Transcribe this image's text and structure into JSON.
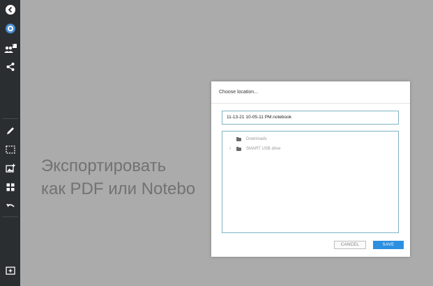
{
  "overlay": {
    "line1": "Экспортировать",
    "line2": "как PDF или Notebo"
  },
  "dialog": {
    "title": "Choose location...",
    "filename": "11-13-21 10-05-11 PM.notebook",
    "folders": [
      {
        "label": "Downloads",
        "expandable": false
      },
      {
        "label": "SMART USB drive",
        "expandable": true
      }
    ],
    "cancel_label": "CANCEL",
    "save_label": "SAVE"
  },
  "sidebar": {
    "participants_badge": "0",
    "icons": [
      "back-icon",
      "app-logo-icon",
      "participants-icon",
      "share-icon",
      "pen-icon",
      "select-icon",
      "add-image-icon",
      "widgets-icon",
      "undo-icon",
      "add-page-icon"
    ]
  },
  "colors": {
    "sidebar": "#2b2e31",
    "canvas": "#ababab",
    "accent": "#2c8fe0",
    "field_border": "#7fb2c4"
  }
}
